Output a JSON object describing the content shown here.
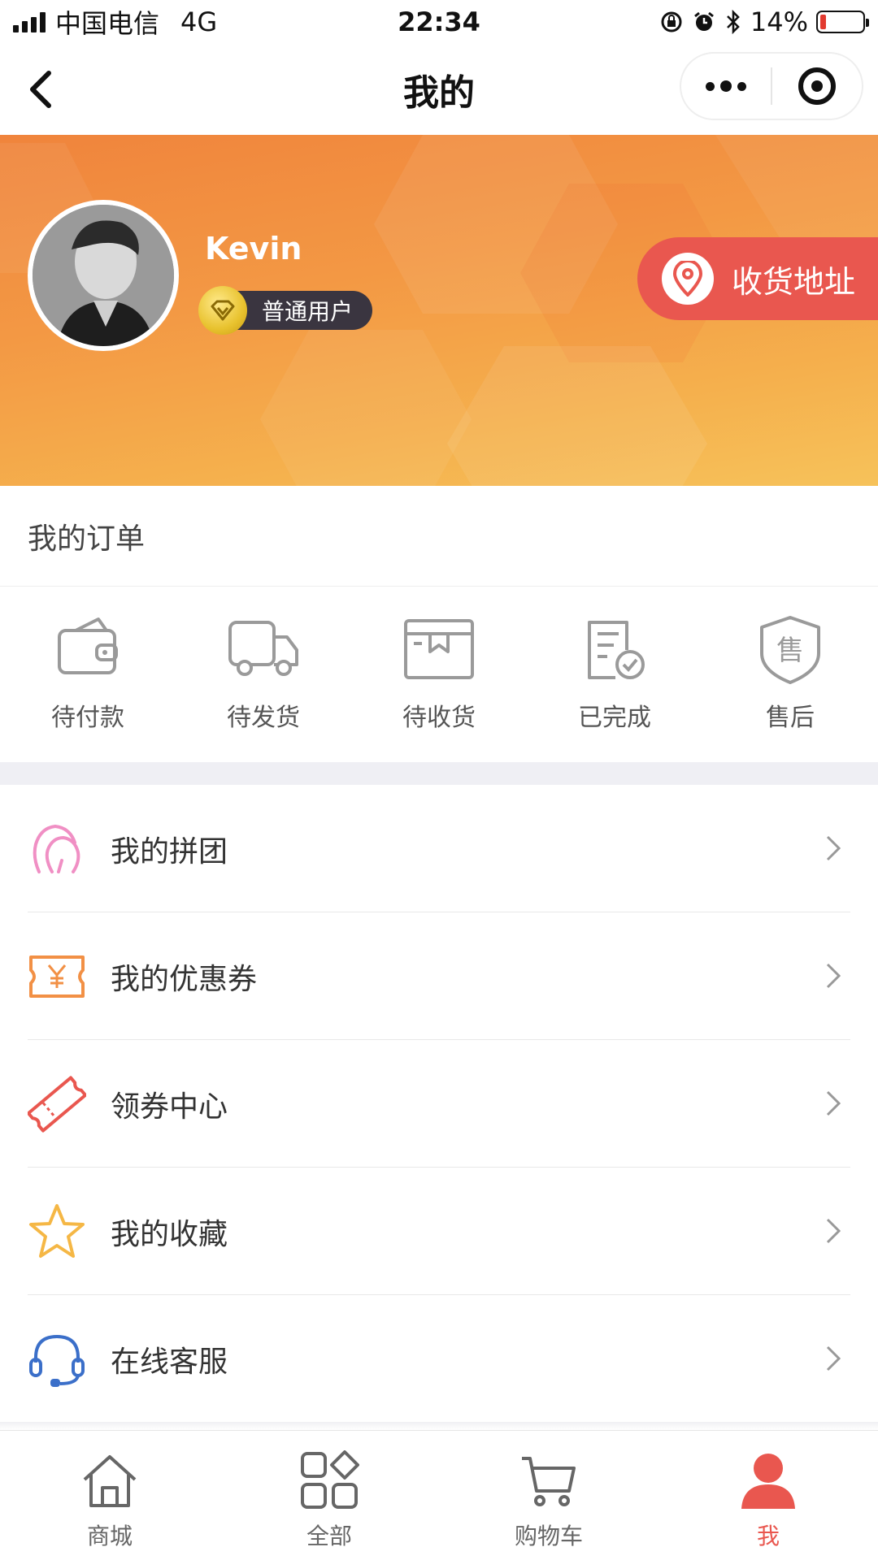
{
  "status_bar": {
    "carrier": "中国电信",
    "network": "4G",
    "time": "22:34",
    "battery": "14%"
  },
  "nav": {
    "title": "我的"
  },
  "profile": {
    "username": "Kevin",
    "level": "普通用户",
    "address_button": "收货地址"
  },
  "orders": {
    "title": "我的订单",
    "items": [
      {
        "label": "待付款",
        "icon": "wallet-icon"
      },
      {
        "label": "待发货",
        "icon": "truck-icon"
      },
      {
        "label": "待收货",
        "icon": "box-icon"
      },
      {
        "label": "已完成",
        "icon": "checked-document-icon"
      },
      {
        "label": "售后",
        "icon": "shield-icon"
      }
    ]
  },
  "menu": [
    {
      "label": "我的拼团",
      "icon": "group-icon",
      "color": "#f08fc4"
    },
    {
      "label": "我的优惠券",
      "icon": "coupon-icon",
      "color": "#f29045"
    },
    {
      "label": "领券中心",
      "icon": "ticket-icon",
      "color": "#e9574f"
    },
    {
      "label": "我的收藏",
      "icon": "star-icon",
      "color": "#f5b745"
    },
    {
      "label": "在线客服",
      "icon": "headset-icon",
      "color": "#3b6fc9"
    }
  ],
  "tabbar": [
    {
      "label": "商城",
      "icon": "home-icon"
    },
    {
      "label": "全部",
      "icon": "grid-icon"
    },
    {
      "label": "购物车",
      "icon": "cart-icon"
    },
    {
      "label": "我",
      "icon": "user-icon",
      "active": true
    }
  ],
  "colors": {
    "accent": "#e9574f",
    "banner_start": "#f0843c",
    "banner_end": "#f6c25a",
    "icon_gray": "#999999"
  }
}
